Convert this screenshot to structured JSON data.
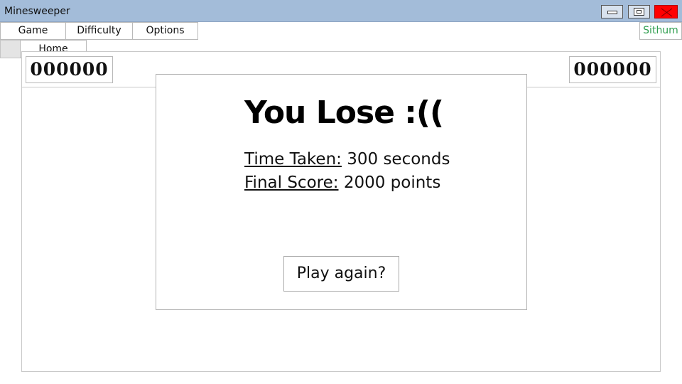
{
  "window": {
    "title": "Minesweeper"
  },
  "menubar": {
    "items": [
      {
        "label": "Game"
      },
      {
        "label": "Difficulty"
      },
      {
        "label": "Options"
      }
    ],
    "user": "Sithum",
    "user_color": "#2f9e4f"
  },
  "game_menu": {
    "items": [
      {
        "label": "Home"
      }
    ]
  },
  "counters": {
    "left": "000000",
    "right": "000000"
  },
  "result_dialog": {
    "title": "You Lose :((",
    "time_label": "Time Taken:",
    "time_value": "300 seconds",
    "score_label": "Final Score:",
    "score_value": "2000 points",
    "play_again_label": "Play again?"
  },
  "colors": {
    "titlebar": "#a3bcd9",
    "close_button": "#ff0000"
  }
}
